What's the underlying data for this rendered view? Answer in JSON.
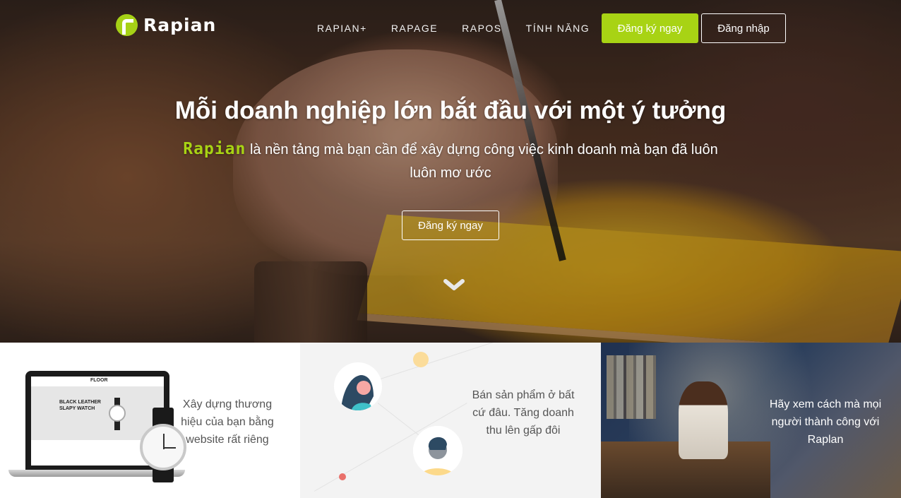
{
  "brand": {
    "name": "Rapian",
    "accent": "#a8d314"
  },
  "nav": {
    "items": [
      "RAPIAN+",
      "RAPAGE",
      "RAPOS",
      "TÍNH NĂNG"
    ]
  },
  "header_buttons": {
    "signup": "Đăng ký ngay",
    "login": "Đăng nhập"
  },
  "hero": {
    "headline": "Mỗi doanh nghiệp lớn bắt đầu với một ý tưởng",
    "sub_brand": "Rapian",
    "sub_text": " là nền tảng mà bạn cần để xây dựng công việc kinh doanh mà bạn đã luôn luôn mơ ước",
    "cta": "Đăng ký ngay",
    "scroll_icon": "chevron-down-icon"
  },
  "features": [
    {
      "text": "Xây dựng thương hiệu của bạn bằng website rất riêng"
    },
    {
      "text": "Bán sản phẩm ở bất cứ đâu. Tăng doanh thu lên gấp đôi"
    },
    {
      "text": "Hãy xem cách mà mọi người thành công với Raplan"
    }
  ],
  "mockup": {
    "store_name": "FLOOR",
    "headline_line1": "BLACK LEATHER",
    "headline_line2": "SLAPY WATCH"
  }
}
